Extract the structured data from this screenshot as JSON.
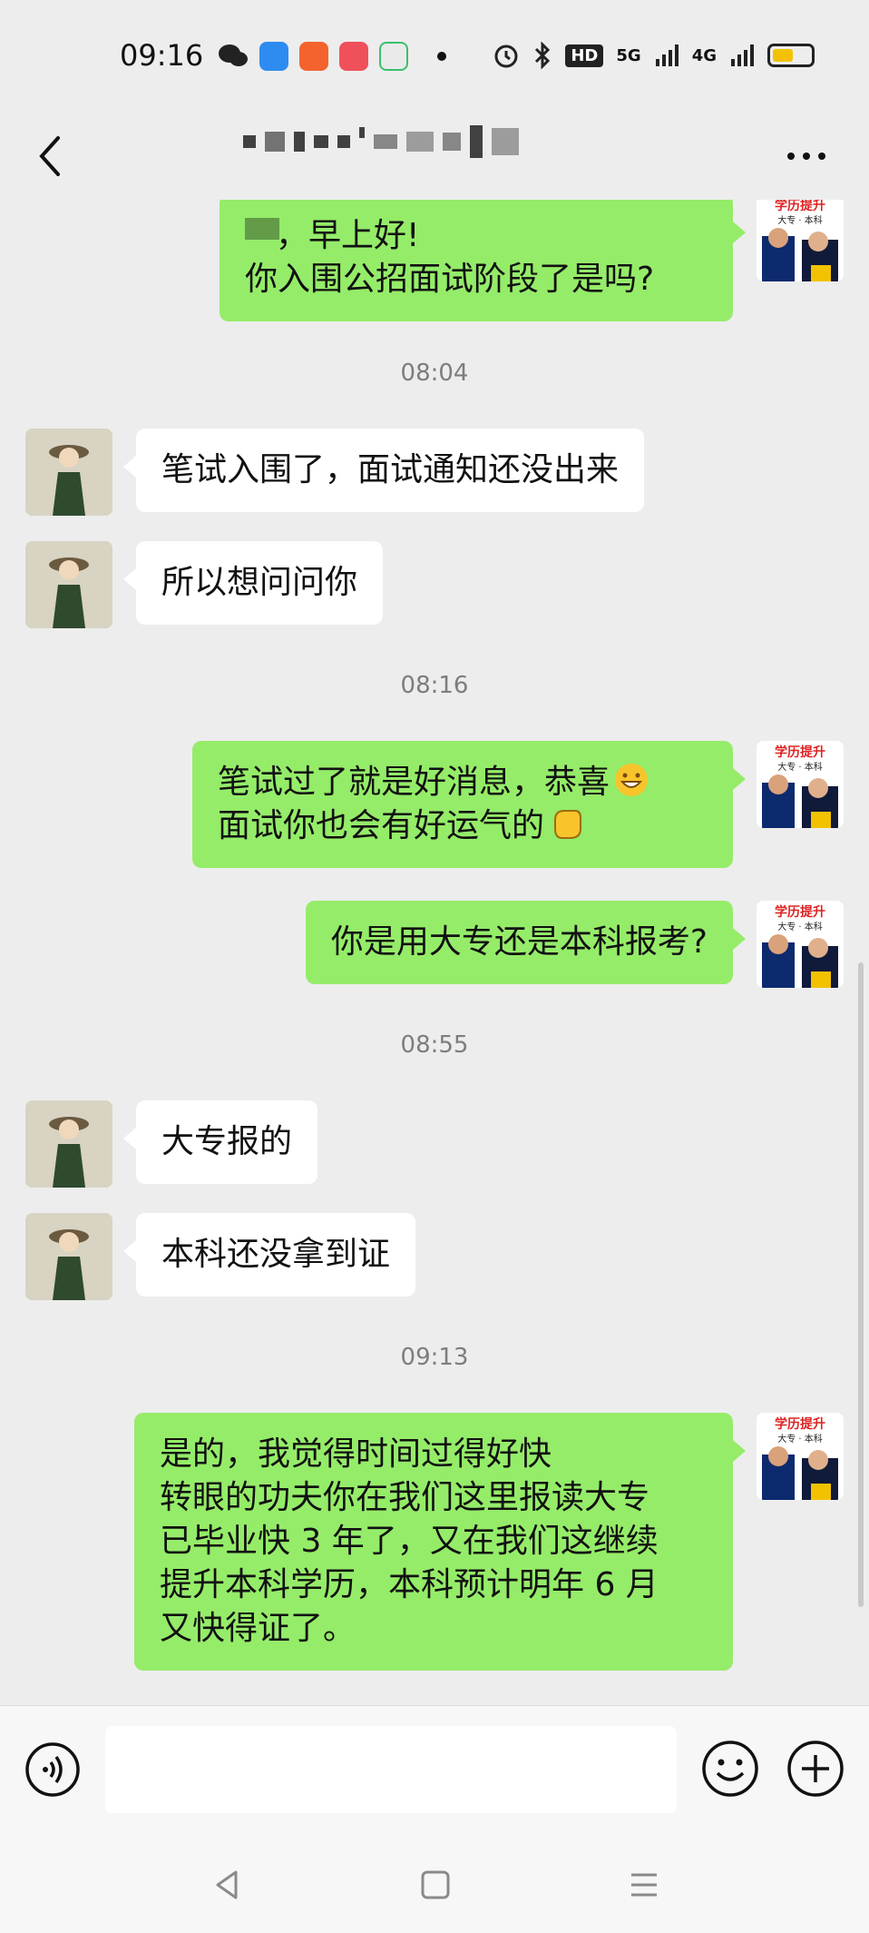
{
  "status_bar": {
    "time": "09:16",
    "network_badge": "HD",
    "signal_5g": "5G",
    "signal_4g": "4G"
  },
  "header": {
    "title": "",
    "back_icon": "chevron-left-icon",
    "more_icon": "more-dots-icon"
  },
  "chat": {
    "timestamps": [
      "08:04",
      "08:16",
      "08:55",
      "09:13"
    ],
    "messages": [
      {
        "side": "right",
        "lines": [
          "，早上好!",
          "你入围公招面试阶段了是吗?"
        ]
      },
      {
        "side": "left",
        "lines": [
          "笔试入围了，面试通知还没出来"
        ]
      },
      {
        "side": "left",
        "lines": [
          "所以想问问你"
        ]
      },
      {
        "side": "right",
        "lines": [
          "笔试过了就是好消息，恭喜",
          "面试你也会有好运气的"
        ]
      },
      {
        "side": "right",
        "lines": [
          "你是用大专还是本科报考?"
        ]
      },
      {
        "side": "left",
        "lines": [
          "大专报的"
        ]
      },
      {
        "side": "left",
        "lines": [
          "本科还没拿到证"
        ]
      },
      {
        "side": "right",
        "lines": [
          "是的，我觉得时间过得好快",
          "转眼的功夫你在我们这里报读大专",
          "已毕业快 3 年了，又在我们这继续",
          "提升本科学历，本科预计明年 6 月",
          "又快得证了。"
        ]
      }
    ],
    "self_avatar_text_top": "学历提升",
    "self_avatar_text_bottom": "大专 · 本科"
  },
  "input_bar": {
    "placeholder": "",
    "voice_icon": "voice-icon",
    "emoji_icon": "emoji-icon",
    "plus_icon": "plus-icon"
  },
  "colors": {
    "background": "#ededed",
    "self_bubble": "#95ec69",
    "friend_bubble": "#ffffff",
    "timestamp_text": "#7d7d7d"
  }
}
